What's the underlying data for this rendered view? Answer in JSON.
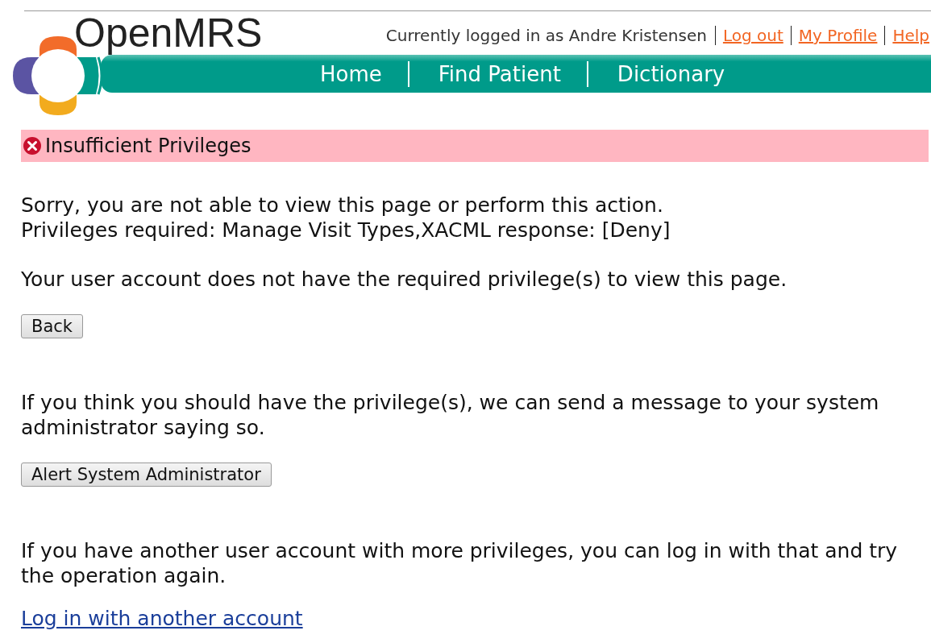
{
  "header": {
    "brand": "OpenMRS",
    "user_text": "Currently logged in as Andre Kristensen",
    "user_links": [
      "Log out",
      "My Profile",
      "Help"
    ],
    "nav": [
      "Home",
      "Find Patient",
      "Dictionary"
    ]
  },
  "alert": {
    "kind": "error",
    "title": "Insufficient Privileges"
  },
  "sections": [
    {
      "kind": "lines",
      "lines": [
        "Sorry, you are not able to view this page or perform this action.",
        "Privileges required: Manage Visit Types,XACML response: [Deny]"
      ]
    },
    {
      "kind": "text",
      "text": "Your user account does not have the required privilege(s) to view this page."
    },
    {
      "kind": "button",
      "label": "Back"
    },
    {
      "kind": "text",
      "text": "If you think you should have the privilege(s), we can send a message to your system administrator saying so."
    },
    {
      "kind": "button",
      "label": "Alert System Administrator"
    },
    {
      "kind": "text",
      "text": "If you have another user account with more privileges, you can log in with that and try the operation again."
    },
    {
      "kind": "link",
      "label": "Log in with another account"
    }
  ]
}
